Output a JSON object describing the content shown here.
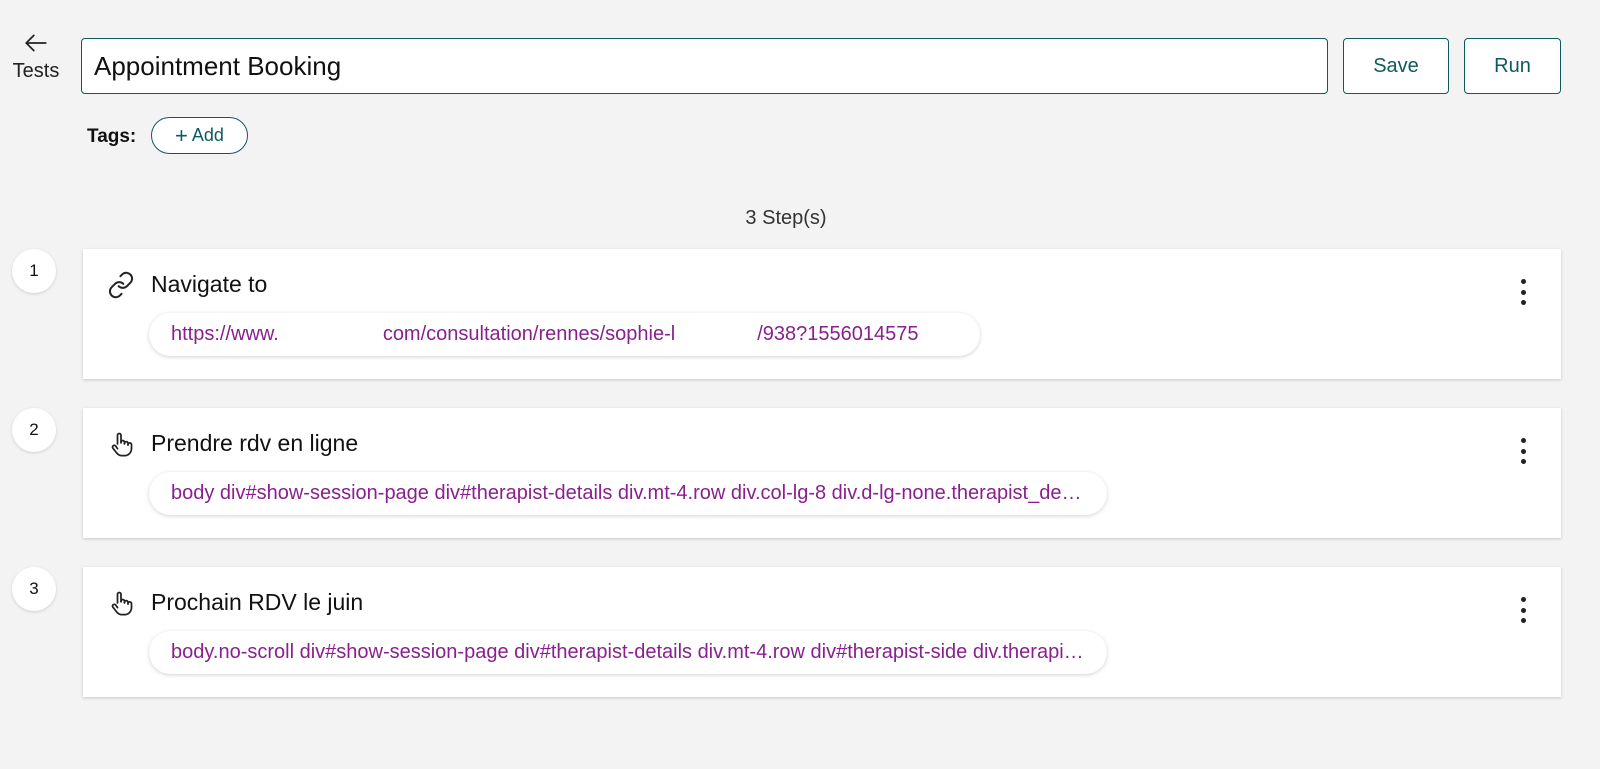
{
  "header": {
    "back_label": "Tests",
    "title_value": "Appointment Booking",
    "save_label": "Save",
    "run_label": "Run"
  },
  "tags": {
    "label": "Tags:",
    "add_label": "Add"
  },
  "steps_summary": "3 Step(s)",
  "steps": [
    {
      "number": "1",
      "icon": "link-icon",
      "title": "Navigate to",
      "target_part1": "https://www.",
      "target_part2": "com/consultation/rennes/sophie-l",
      "target_part3": "/938?1556014575"
    },
    {
      "number": "2",
      "icon": "pointer-hand-icon",
      "title": "Prendre rdv en ligne",
      "target": "body div#show-session-page div#therapist-details div.mt-4.row div.col-lg-8 div.d-lg-none.therapist_details_section a.btn.btn-primary"
    },
    {
      "number": "3",
      "icon": "pointer-hand-icon",
      "title": "Prochain RDV le juin",
      "target": "body.no-scroll div#show-session-page div#therapist-details div.mt-4.row div#therapist-side div.therapist-calendar"
    }
  ],
  "colors": {
    "accent": "#0f5a5e",
    "selector_text": "#8a1f8f",
    "background": "#f3f3f3"
  }
}
